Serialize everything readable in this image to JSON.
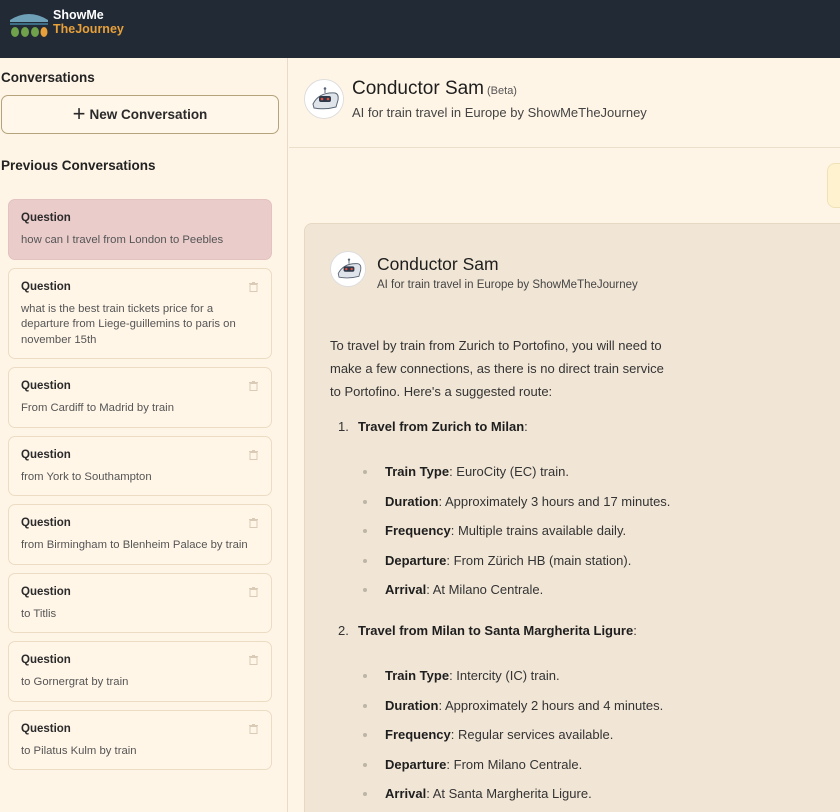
{
  "brand": {
    "line1": "ShowMe",
    "line2": "TheJourney"
  },
  "sidebar": {
    "conversations_title": "Conversations",
    "new_conversation_label": "New Conversation",
    "previous_title": "Previous Conversations",
    "items": [
      {
        "label": "Question",
        "text": "how can I travel from London to Peebles",
        "active": true
      },
      {
        "label": "Question",
        "text": "what is the best train tickets price for a departure from Liege-guillemins to paris on november 15th",
        "active": false
      },
      {
        "label": "Question",
        "text": "From Cardiff to Madrid by train",
        "active": false
      },
      {
        "label": "Question",
        "text": "from York to Southampton",
        "active": false
      },
      {
        "label": "Question",
        "text": "from Birmingham to Blenheim Palace by train",
        "active": false
      },
      {
        "label": "Question",
        "text": "to Titlis",
        "active": false
      },
      {
        "label": "Question",
        "text": "to Gornergrat by train",
        "active": false
      },
      {
        "label": "Question",
        "text": "to Pilatus Kulm by train",
        "active": false
      }
    ]
  },
  "header": {
    "title": "Conductor Sam",
    "beta": "(Beta)",
    "subtitle": "AI for train travel in Europe by ShowMeTheJourney"
  },
  "message": {
    "bot_name": "Conductor Sam",
    "bot_subtitle": "AI for train travel in Europe by ShowMeTheJourney",
    "intro": "To travel by train from Zurich to Portofino, you will need to make a few connections, as there is no direct train service to Portofino. Here's a suggested route:",
    "steps": [
      {
        "num": "1.",
        "title": "Travel from Zurich to Milan",
        "details": [
          {
            "label": "Train Type",
            "value": ": EuroCity (EC) train."
          },
          {
            "label": "Duration",
            "value": ": Approximately 3 hours and 17 minutes."
          },
          {
            "label": "Frequency",
            "value": ": Multiple trains available daily."
          },
          {
            "label": "Departure",
            "value": ": From Zürich HB (main station)."
          },
          {
            "label": "Arrival",
            "value": ": At Milano Centrale."
          }
        ]
      },
      {
        "num": "2.",
        "title": "Travel from Milan to Santa Margherita Ligure",
        "details": [
          {
            "label": "Train Type",
            "value": ": Intercity (IC) train."
          },
          {
            "label": "Duration",
            "value": ": Approximately 2 hours and 4 minutes."
          },
          {
            "label": "Frequency",
            "value": ": Regular services available."
          },
          {
            "label": "Departure",
            "value": ": From Milano Centrale."
          },
          {
            "label": "Arrival",
            "value": ": At Santa Margherita Ligure."
          }
        ]
      }
    ]
  },
  "colors": {
    "topbar": "#222a36",
    "accent": "#e7a03a",
    "background": "#fff5e6",
    "active_item": "#eacccb",
    "bot_card": "#f1e6d6"
  }
}
